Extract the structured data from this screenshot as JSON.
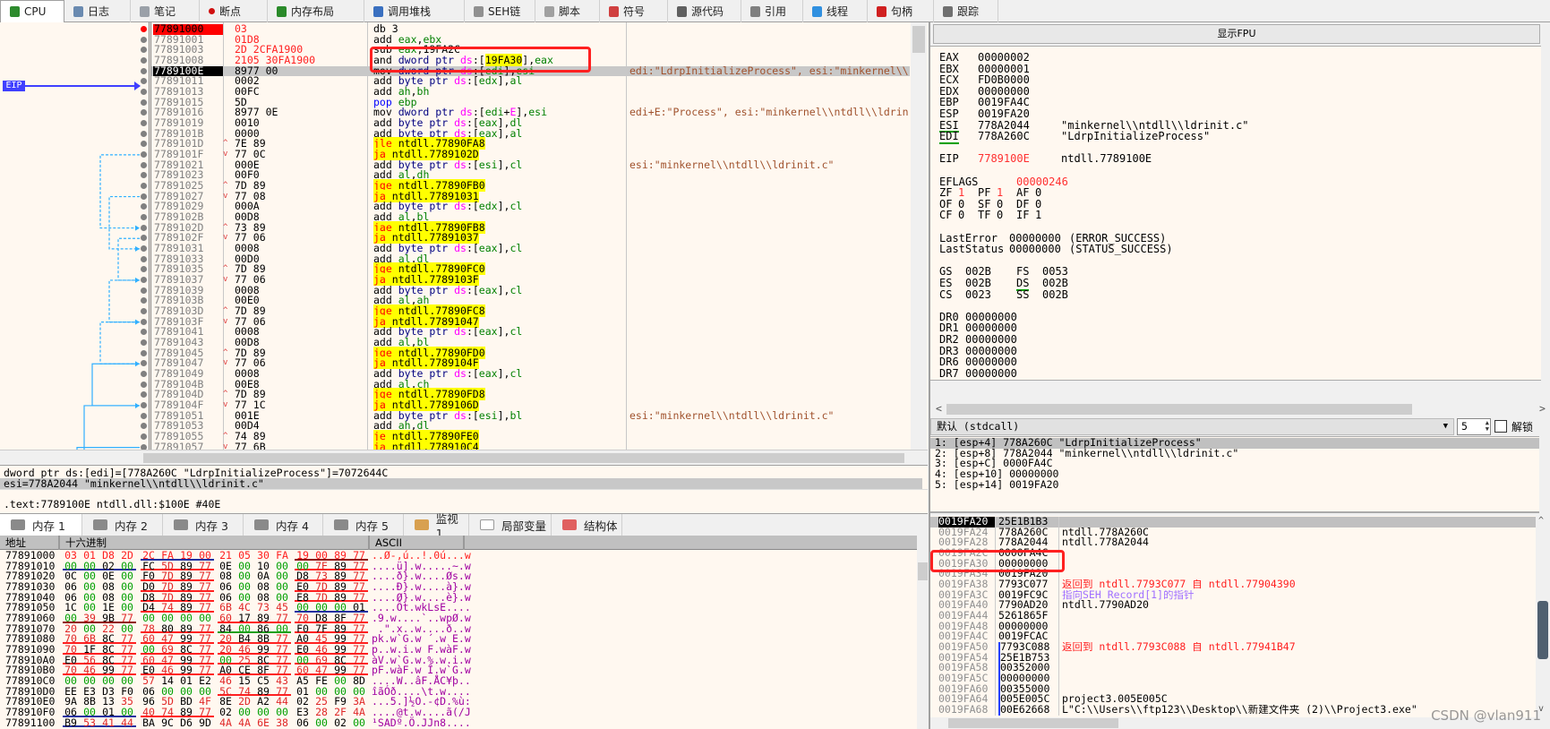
{
  "tabs": [
    {
      "label": "CPU",
      "icon": "cpu-icon",
      "color": "#2e8b2e",
      "selected": true
    },
    {
      "label": "日志",
      "icon": "log-icon",
      "color": "#6a8ab0"
    },
    {
      "label": "笔记",
      "icon": "notes-icon",
      "color": "#9aa0a8"
    },
    {
      "label": "断点",
      "icon": "breakpoint-icon",
      "color": "#d01010"
    },
    {
      "label": "内存布局",
      "icon": "memory-map-icon",
      "color": "#2a8a2a"
    },
    {
      "label": "调用堆栈",
      "icon": "call-stack-icon",
      "color": "#3a70c0"
    },
    {
      "label": "SEH链",
      "icon": "seh-chain-icon",
      "color": "#909090"
    },
    {
      "label": "脚本",
      "icon": "script-icon",
      "color": "#a0a0a0"
    },
    {
      "label": "符号",
      "icon": "symbol-icon",
      "color": "#d04040"
    },
    {
      "label": "源代码",
      "icon": "source-icon",
      "color": "#606060"
    },
    {
      "label": "引用",
      "icon": "references-icon",
      "color": "#808080"
    },
    {
      "label": "线程",
      "icon": "threads-icon",
      "color": "#3090e0"
    },
    {
      "label": "句柄",
      "icon": "handles-icon",
      "color": "#d02020"
    },
    {
      "label": "跟踪",
      "icon": "trace-icon",
      "color": "#707070"
    }
  ],
  "disasm": {
    "eip_label": "EIP",
    "highlighted_token": "19FA30",
    "rows": [
      {
        "addr": "77891000",
        "bytes": "03",
        "ins": "db 3",
        "bp": true,
        "mod": true
      },
      {
        "addr": "77891001",
        "bytes": "01D8",
        "ins": "add eax,ebx",
        "mod": true
      },
      {
        "addr": "77891003",
        "bytes": "2D 2CFA1900",
        "ins": "sub eax,19FA2C",
        "mod": true
      },
      {
        "addr": "77891008",
        "bytes": "2105 30FA1900",
        "ins": "and dword ptr ds:[19FA30],eax",
        "mod": true
      },
      {
        "addr": "7789100E",
        "bytes": "8977 00",
        "ins": "mov dword ptr ds:[edi],esi",
        "eip": true,
        "comment": "edi:\"LdrpInitializeProcess\", esi:\"minkernel\\\\ntdll\\\\ldrinit.c\""
      },
      {
        "addr": "77891011",
        "bytes": "0002",
        "ins": "add byte ptr ds:[edx],al"
      },
      {
        "addr": "77891013",
        "bytes": "00FC",
        "ins": "add ah,bh"
      },
      {
        "addr": "77891015",
        "bytes": "5D",
        "ins": "pop ebp"
      },
      {
        "addr": "77891016",
        "bytes": "8977 0E",
        "ins": "mov dword ptr ds:[edi+E],esi",
        "comment": "edi+E:\"Process\", esi:\"minkernel\\\\ntdll\\\\ldrinit.c\""
      },
      {
        "addr": "77891019",
        "bytes": "0010",
        "ins": "add byte ptr ds:[eax],dl"
      },
      {
        "addr": "7789101B",
        "bytes": "0000",
        "ins": "add byte ptr ds:[eax],al"
      },
      {
        "addr": "7789101D",
        "bytes": "7E 89",
        "ins": "jle ntdll.77890FA8",
        "dir": "^"
      },
      {
        "addr": "7789101F",
        "bytes": "77 0C",
        "ins": "ja ntdll.7789102D",
        "dir": "v"
      },
      {
        "addr": "77891021",
        "bytes": "000E",
        "ins": "add byte ptr ds:[esi],cl",
        "comment": "esi:\"minkernel\\\\ntdll\\\\ldrinit.c\""
      },
      {
        "addr": "77891023",
        "bytes": "00F0",
        "ins": "add al,dh"
      },
      {
        "addr": "77891025",
        "bytes": "7D 89",
        "ins": "jge ntdll.77890FB0",
        "dir": "^"
      },
      {
        "addr": "77891027",
        "bytes": "77 08",
        "ins": "ja ntdll.77891031",
        "dir": "v"
      },
      {
        "addr": "77891029",
        "bytes": "000A",
        "ins": "add byte ptr ds:[edx],cl"
      },
      {
        "addr": "7789102B",
        "bytes": "00D8",
        "ins": "add al,bl"
      },
      {
        "addr": "7789102D",
        "bytes": "73 89",
        "ins": "jae ntdll.77890FB8",
        "dir": "^"
      },
      {
        "addr": "7789102F",
        "bytes": "77 06",
        "ins": "ja ntdll.77891037",
        "dir": "v"
      },
      {
        "addr": "77891031",
        "bytes": "0008",
        "ins": "add byte ptr ds:[eax],cl"
      },
      {
        "addr": "77891033",
        "bytes": "00D0",
        "ins": "add al,dl"
      },
      {
        "addr": "77891035",
        "bytes": "7D 89",
        "ins": "jge ntdll.77890FC0",
        "dir": "^"
      },
      {
        "addr": "77891037",
        "bytes": "77 06",
        "ins": "ja ntdll.7789103F",
        "dir": "v"
      },
      {
        "addr": "77891039",
        "bytes": "0008",
        "ins": "add byte ptr ds:[eax],cl"
      },
      {
        "addr": "7789103B",
        "bytes": "00E0",
        "ins": "add al,ah"
      },
      {
        "addr": "7789103D",
        "bytes": "7D 89",
        "ins": "jge ntdll.77890FC8",
        "dir": "^"
      },
      {
        "addr": "7789103F",
        "bytes": "77 06",
        "ins": "ja ntdll.77891047",
        "dir": "v"
      },
      {
        "addr": "77891041",
        "bytes": "0008",
        "ins": "add byte ptr ds:[eax],cl"
      },
      {
        "addr": "77891043",
        "bytes": "00D8",
        "ins": "add al,bl"
      },
      {
        "addr": "77891045",
        "bytes": "7D 89",
        "ins": "jge ntdll.77890FD0",
        "dir": "^"
      },
      {
        "addr": "77891047",
        "bytes": "77 06",
        "ins": "ja ntdll.7789104F",
        "dir": "v"
      },
      {
        "addr": "77891049",
        "bytes": "0008",
        "ins": "add byte ptr ds:[eax],cl"
      },
      {
        "addr": "7789104B",
        "bytes": "00E8",
        "ins": "add al,ch"
      },
      {
        "addr": "7789104D",
        "bytes": "7D 89",
        "ins": "jge ntdll.77890FD8",
        "dir": "^"
      },
      {
        "addr": "7789104F",
        "bytes": "77 1C",
        "ins": "ja ntdll.7789106D",
        "dir": "v"
      },
      {
        "addr": "77891051",
        "bytes": "001E",
        "ins": "add byte ptr ds:[esi],bl",
        "comment": "esi:\"minkernel\\\\ntdll\\\\ldrinit.c\""
      },
      {
        "addr": "77891053",
        "bytes": "00D4",
        "ins": "add ah,dl"
      },
      {
        "addr": "77891055",
        "bytes": "74 89",
        "ins": "je ntdll.77890FE0",
        "dir": "^"
      },
      {
        "addr": "77891057",
        "bytes": "77 6B",
        "ins": "ja ntdll.778910C4",
        "dir": "v"
      }
    ]
  },
  "info": {
    "line1": "dword ptr ds:[edi]=[778A260C \"LdrpInitializeProcess\"]=7072644C",
    "line2": "esi=778A2044 \"minkernel\\\\ntdll\\\\ldrinit.c\"",
    "line3": ".text:7789100E ntdll.dll:$100E #40E"
  },
  "memtabs": [
    {
      "label": "内存 1",
      "icon": "memory-icon",
      "selected": true
    },
    {
      "label": "内存 2",
      "icon": "memory-icon"
    },
    {
      "label": "内存 3",
      "icon": "memory-icon"
    },
    {
      "label": "内存 4",
      "icon": "memory-icon"
    },
    {
      "label": "内存 5",
      "icon": "memory-icon"
    },
    {
      "label": "监视 1",
      "icon": "watch-icon"
    },
    {
      "label": "局部变量",
      "icon": "locals-icon"
    },
    {
      "label": "结构体",
      "icon": "struct-icon"
    }
  ],
  "memory": {
    "headers": {
      "addr": "地址",
      "hex": "十六进制",
      "ascii": "ASCII"
    },
    "rows": [
      {
        "addr": "77891000",
        "hex": "03 01 D8 2D 2C FA 19 00 21 05 30 FA 19 00 89 77",
        "ascii": "..Ø-,ú..!.0ú...w",
        "ul": [
          "",
          "b",
          "",
          "dr"
        ],
        "mod": true
      },
      {
        "addr": "77891010",
        "hex": "00 00 02 00 FC 5D 89 77 0E 00 10 00 00 7E 89 77",
        "ascii": "....ü].w.....~.w",
        "ul": [
          "b",
          "r",
          "",
          "r"
        ]
      },
      {
        "addr": "77891020",
        "hex": "0C 00 0E 00 F0 7D 89 77 08 00 0A 00 D8 73 89 77",
        "ascii": "....ð}.w....Øs.w",
        "ul": [
          "",
          "r",
          "",
          "r"
        ]
      },
      {
        "addr": "77891030",
        "hex": "06 00 08 00 D0 7D 89 77 06 00 08 00 E0 7D 89 77",
        "ascii": "....Ð}.w....à}.w",
        "ul": [
          "",
          "r",
          "",
          "r"
        ]
      },
      {
        "addr": "77891040",
        "hex": "06 00 08 00 D8 7D 89 77 06 00 08 00 E8 7D 89 77",
        "ascii": "....Ø}.w....è}.w",
        "ul": [
          "",
          "r",
          "",
          "r"
        ]
      },
      {
        "addr": "77891050",
        "hex": "1C 00 1E 00 D4 74 89 77 6B 4C 73 45 00 00 00 01",
        "ascii": "....Ôt.wkLsE....",
        "ul": [
          "",
          "r",
          "",
          "b"
        ]
      },
      {
        "addr": "77891060",
        "hex": "00 39 9B 77 00 00 00 00 60 17 89 77 70 D8 8F 77",
        "ascii": ".9.w....`..wpØ.w",
        "ul": [
          "dr",
          "",
          "r",
          "r"
        ]
      },
      {
        "addr": "77891070",
        "hex": "20 00 22 00 78 80 89 77 84 00 86 00 F0 7F 89 77",
        "ascii": " .\".x..w....ð..w",
        "ul": [
          "",
          "r",
          "g",
          "r"
        ]
      },
      {
        "addr": "77891080",
        "hex": "70 6B 8C 77 60 47 99 77 20 B4 8B 77 A0 45 99 77",
        "ascii": "pk.w`G.w ´.w E.w",
        "ul": [
          "r",
          "r",
          "r",
          "r"
        ]
      },
      {
        "addr": "77891090",
        "hex": "70 1F 8C 77 00 69 8C 77 20 46 99 77 E0 46 99 77",
        "ascii": "p..w.i.w F.wàF.w",
        "ul": [
          "r",
          "r",
          "r",
          "r"
        ]
      },
      {
        "addr": "778910A0",
        "hex": "E0 56 8C 77 60 47 99 77 00 25 8C 77 00 69 8C 77",
        "ascii": "àV.w`G.w.%.w.i.w",
        "ul": [
          "r",
          "r",
          "r",
          "r"
        ]
      },
      {
        "addr": "778910B0",
        "hex": "70 46 99 77 E0 46 99 77 A0 CE 8F 77 60 47 99 77",
        "ascii": "pF.wàF.w Î.w`G.w",
        "ul": [
          "r",
          "r",
          "r",
          "r"
        ]
      },
      {
        "addr": "778910C0",
        "hex": "00 00 00 00 57 14 01 E2 46 15 C5 43 A5 FE 00 8D",
        "ascii": "....W..âF.ÅC¥þ..",
        "ul": [
          "",
          "",
          "",
          ""
        ]
      },
      {
        "addr": "778910D0",
        "hex": "EE E3 D3 F0 06 00 00 00 5C 74 89 77 01 00 00 00",
        "ascii": "îãÓð....\\t.w....",
        "ul": [
          "",
          "",
          "r",
          ""
        ]
      },
      {
        "addr": "778910E0",
        "hex": "9A 8B 13 35 96 5D BD 4F 8E 2D A2 44 02 25 F9 3A",
        "ascii": "...5.]½O.-¢D.%ù:",
        "ul": [
          "",
          "",
          "",
          ""
        ]
      },
      {
        "addr": "778910F0",
        "hex": "06 00 01 00 40 74 89 77 02 00 00 00 E3 28 2F 4A",
        "ascii": "....@t.w....ã(/J",
        "ul": [
          "b",
          "r",
          "",
          ""
        ]
      },
      {
        "addr": "77891100",
        "hex": "B9 53 41 44 BA 9C D6 9D 4A 4A 6E 38 06 00 02 00",
        "ascii": "¹SADº.Ö.JJn8....",
        "ul": [
          "b",
          "",
          "",
          ""
        ]
      }
    ]
  },
  "fpu_button": "显示FPU",
  "registers": [
    {
      "line": 0,
      "name": "EAX",
      "value": "00000002"
    },
    {
      "line": 1,
      "name": "EBX",
      "value": "00000001"
    },
    {
      "line": 2,
      "name": "ECX",
      "value": "FD0B0000"
    },
    {
      "line": 3,
      "name": "EDX",
      "value": "00000000"
    },
    {
      "line": 4,
      "name": "EBP",
      "value": "0019FA4C"
    },
    {
      "line": 5,
      "name": "ESP",
      "value": "0019FA20"
    },
    {
      "line": 6,
      "name": "ESI",
      "value": "778A2044",
      "comment": "\"minkernel\\\\ntdll\\\\ldrinit.c\"",
      "underline": true
    },
    {
      "line": 7,
      "name": "EDI",
      "value": "778A260C",
      "comment": "\"LdrpInitializeProcess\"",
      "underline": true
    },
    {
      "line": 9,
      "name": "EIP",
      "value": "7789100E",
      "comment": "ntdll.7789100E",
      "changed": true
    }
  ],
  "eflags": {
    "name": "EFLAGS",
    "value": "00000246",
    "flags": [
      [
        {
          "n": "ZF",
          "v": "1",
          "c": true
        },
        {
          "n": "PF",
          "v": "1",
          "c": true
        },
        {
          "n": "AF",
          "v": "0"
        }
      ],
      [
        {
          "n": "OF",
          "v": "0"
        },
        {
          "n": "SF",
          "v": "0"
        },
        {
          "n": "DF",
          "v": "0"
        }
      ],
      [
        {
          "n": "CF",
          "v": "0"
        },
        {
          "n": "TF",
          "v": "0"
        },
        {
          "n": "IF",
          "v": "1"
        }
      ]
    ]
  },
  "last": [
    {
      "name": "LastError",
      "value": "00000000",
      "desc": "(ERROR_SUCCESS)"
    },
    {
      "name": "LastStatus",
      "value": "00000000",
      "desc": "(STATUS_SUCCESS)"
    }
  ],
  "segments": [
    [
      {
        "n": "GS",
        "v": "002B"
      },
      {
        "n": "FS",
        "v": "0053"
      }
    ],
    [
      {
        "n": "ES",
        "v": "002B"
      },
      {
        "n": "DS",
        "v": "002B",
        "u": true
      }
    ],
    [
      {
        "n": "CS",
        "v": "0023"
      },
      {
        "n": "SS",
        "v": "002B"
      }
    ]
  ],
  "debug_regs": [
    {
      "n": "DR0",
      "v": "00000000"
    },
    {
      "n": "DR1",
      "v": "00000000"
    },
    {
      "n": "DR2",
      "v": "00000000"
    },
    {
      "n": "DR3",
      "v": "00000000"
    },
    {
      "n": "DR6",
      "v": "00000000"
    },
    {
      "n": "DR7",
      "v": "00000000"
    }
  ],
  "callconv": {
    "selected": "默认 (stdcall)",
    "arg_count": "5",
    "unlock_label": "解锁",
    "unlock_checked": false
  },
  "args": [
    "1: [esp+4] 778A260C \"LdrpInitializeProcess\"",
    "2: [esp+8] 778A2044 \"minkernel\\\\ntdll\\\\ldrinit.c\"",
    "3: [esp+C] 0000FA4C",
    "4: [esp+10] 00000000",
    "5: [esp+14] 0019FA20"
  ],
  "stack": [
    {
      "addr": "0019FA20",
      "value": "25E1B1B3",
      "selected": true
    },
    {
      "addr": "0019FA24",
      "value": "778A260C",
      "comment": "ntdll.778A260C"
    },
    {
      "addr": "0019FA28",
      "value": "778A2044",
      "comment": "ntdll.778A2044"
    },
    {
      "addr": "0019FA2C",
      "value": "0000FA4C"
    },
    {
      "addr": "0019FA30",
      "value": "00000000"
    },
    {
      "addr": "0019FA34",
      "value": "0019FA20"
    },
    {
      "addr": "0019FA38",
      "value": "7793C077",
      "comment": "返回到 ntdll.7793C077 自 ntdll.77904390",
      "kind": "ret"
    },
    {
      "addr": "0019FA3C",
      "value": "0019FC9C",
      "comment": "指向SEH_Record[1]的指针",
      "kind": "seh"
    },
    {
      "addr": "0019FA40",
      "value": "7790AD20",
      "comment": "ntdll.7790AD20"
    },
    {
      "addr": "0019FA44",
      "value": "5261865F"
    },
    {
      "addr": "0019FA48",
      "value": "00000000"
    },
    {
      "addr": "0019FA4C",
      "value": "0019FCAC"
    },
    {
      "addr": "0019FA50",
      "value": "7793C088",
      "comment": "返回到 ntdll.7793C088 自 ntdll.77941B47",
      "kind": "ret"
    },
    {
      "addr": "0019FA54",
      "value": "25E1B753"
    },
    {
      "addr": "0019FA58",
      "value": "00352000"
    },
    {
      "addr": "0019FA5C",
      "value": "00000000"
    },
    {
      "addr": "0019FA60",
      "value": "00355000"
    },
    {
      "addr": "0019FA64",
      "value": "005E005C",
      "comment": "project3.005E005C"
    },
    {
      "addr": "0019FA68",
      "value": "00E62668",
      "comment": "L\"C:\\\\Users\\\\ftp123\\\\Desktop\\\\新建文件夹 (2)\\\\Project3.exe\""
    }
  ],
  "colors": {
    "background": "#fff8f0",
    "highlight": "#ffff00",
    "annotation_box": "#ff2020",
    "return_comment": "#ff2020",
    "seh_comment": "#a070ff",
    "eip_marker": "#4040ff"
  },
  "watermark": "CSDN @vlan911"
}
